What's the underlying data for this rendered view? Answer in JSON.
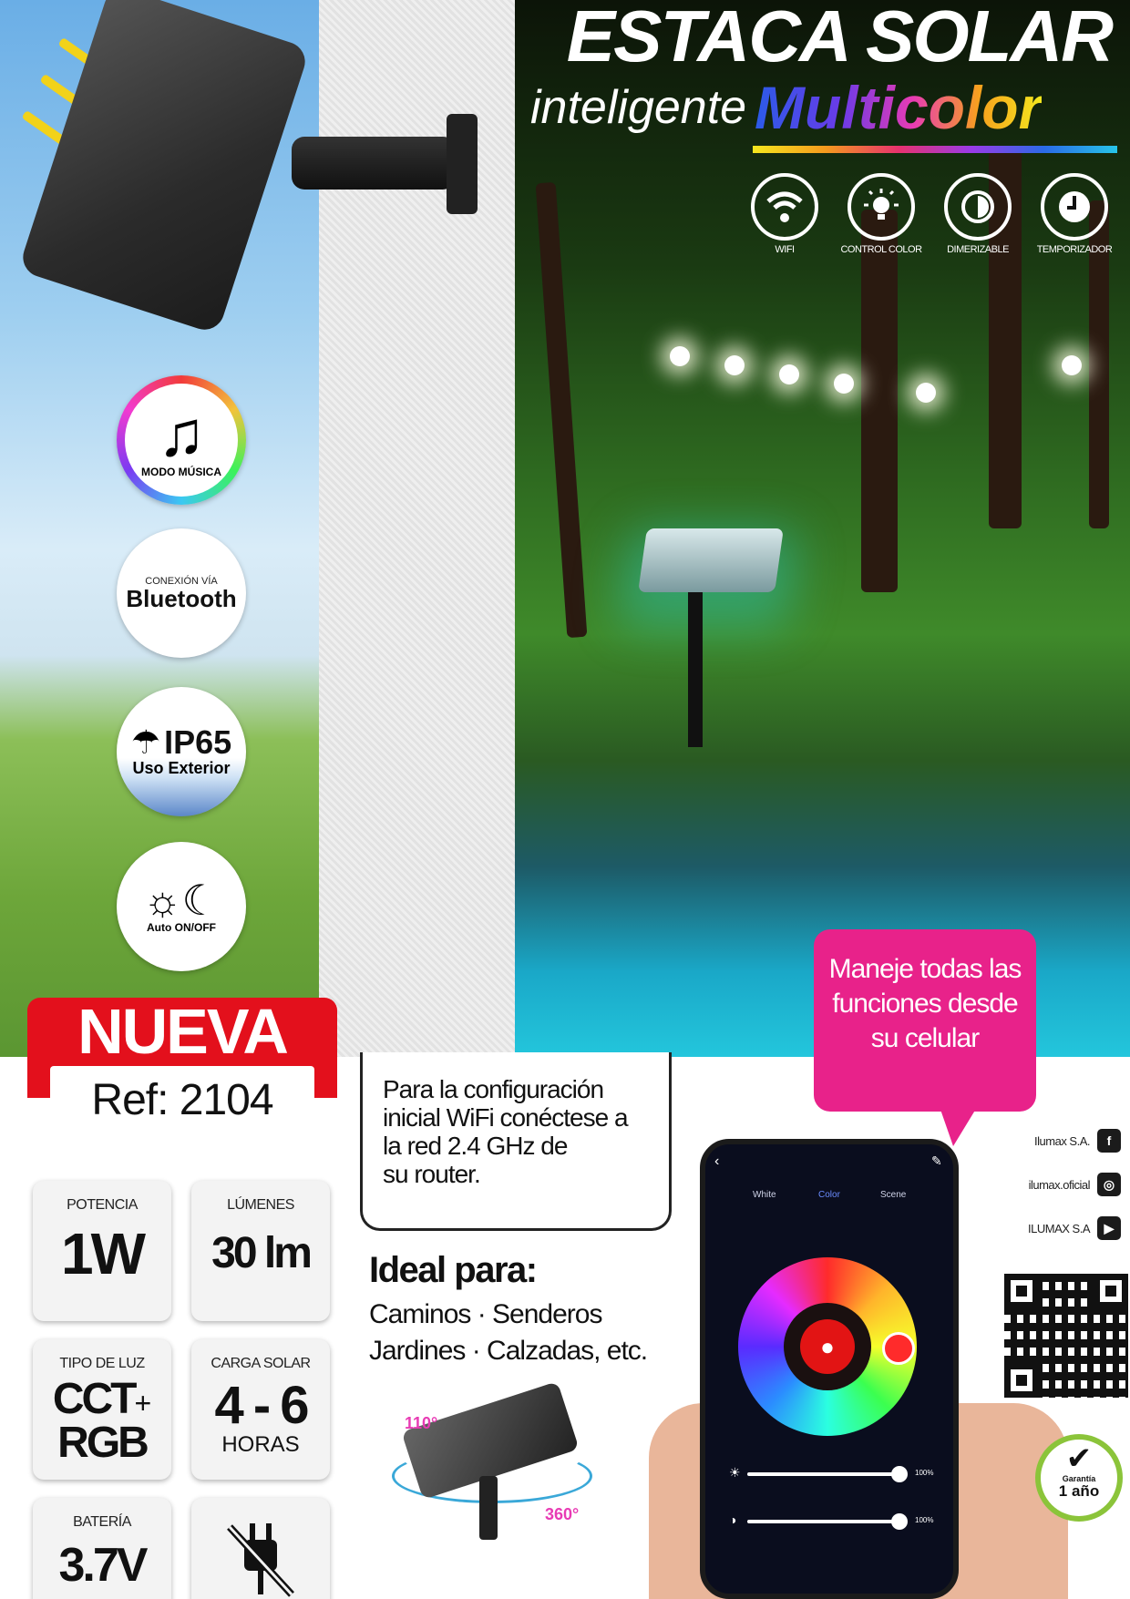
{
  "header": {
    "title_main": "ESTACA SOLAR",
    "title_sub1": "inteligente",
    "title_sub2": "Multicolor"
  },
  "features": [
    {
      "label": "WIFI",
      "icon": "wifi-icon"
    },
    {
      "label": "CONTROL COLOR",
      "icon": "bulb-icon"
    },
    {
      "label": "DIMERIZABLE",
      "icon": "dimmer-icon"
    },
    {
      "label": "TEMPORIZADOR",
      "icon": "clock-icon"
    }
  ],
  "badges": {
    "music": "MODO MÚSICA",
    "bt_small": "CONEXIÓN VÍA",
    "bt_big": "Bluetooth",
    "ip_big": "IP65",
    "ip_small": "Uso Exterior",
    "auto": "Auto ON/OFF"
  },
  "product": {
    "nueva": "NUEVA",
    "ref": "Ref: 2104"
  },
  "specs": {
    "potencia_label": "POTENCIA",
    "potencia_value": "1W",
    "lumenes_label": "LÚMENES",
    "lumenes_value": "30 lm",
    "tipo_label": "TIPO DE LUZ",
    "tipo_value_1": "CCT",
    "tipo_plus": "+",
    "tipo_value_2": "RGB",
    "carga_label": "CARGA SOLAR",
    "carga_value": "4 - 6",
    "carga_unit": "HORAS",
    "bateria_label": "BATERÍA",
    "bateria_value": "3.7V"
  },
  "config": {
    "text_lines": [
      "Para la configuración",
      "inicial WiFi  conéctese a",
      "la red 2.4 GHz de",
      "su router."
    ]
  },
  "ideal": {
    "title": "Ideal para:",
    "line1": "Caminos · Senderos",
    "line2": "Jardines · Calzadas, etc."
  },
  "angles": {
    "a1": "110°",
    "a2": "360°"
  },
  "bubble": {
    "lines": [
      "Maneje todas las",
      "funciones desde",
      "su celular"
    ]
  },
  "app": {
    "tabs": [
      "White",
      "Color",
      "Scene"
    ],
    "pct1": "100%",
    "pct2": "100%"
  },
  "socials": [
    {
      "name": "Ilumax S.A.",
      "icon": "facebook-icon",
      "glyph": "f"
    },
    {
      "name": "ilumax.oficial",
      "icon": "instagram-icon",
      "glyph": "◎"
    },
    {
      "name": "ILUMAX S.A",
      "icon": "youtube-icon",
      "glyph": "▶"
    }
  ],
  "warranty": {
    "line1": "Garantía",
    "line2": "1 año"
  },
  "colors": {
    "brand_red": "#e3101c",
    "bubble_pink": "#e8228a",
    "warranty_green": "#8bc43a"
  }
}
